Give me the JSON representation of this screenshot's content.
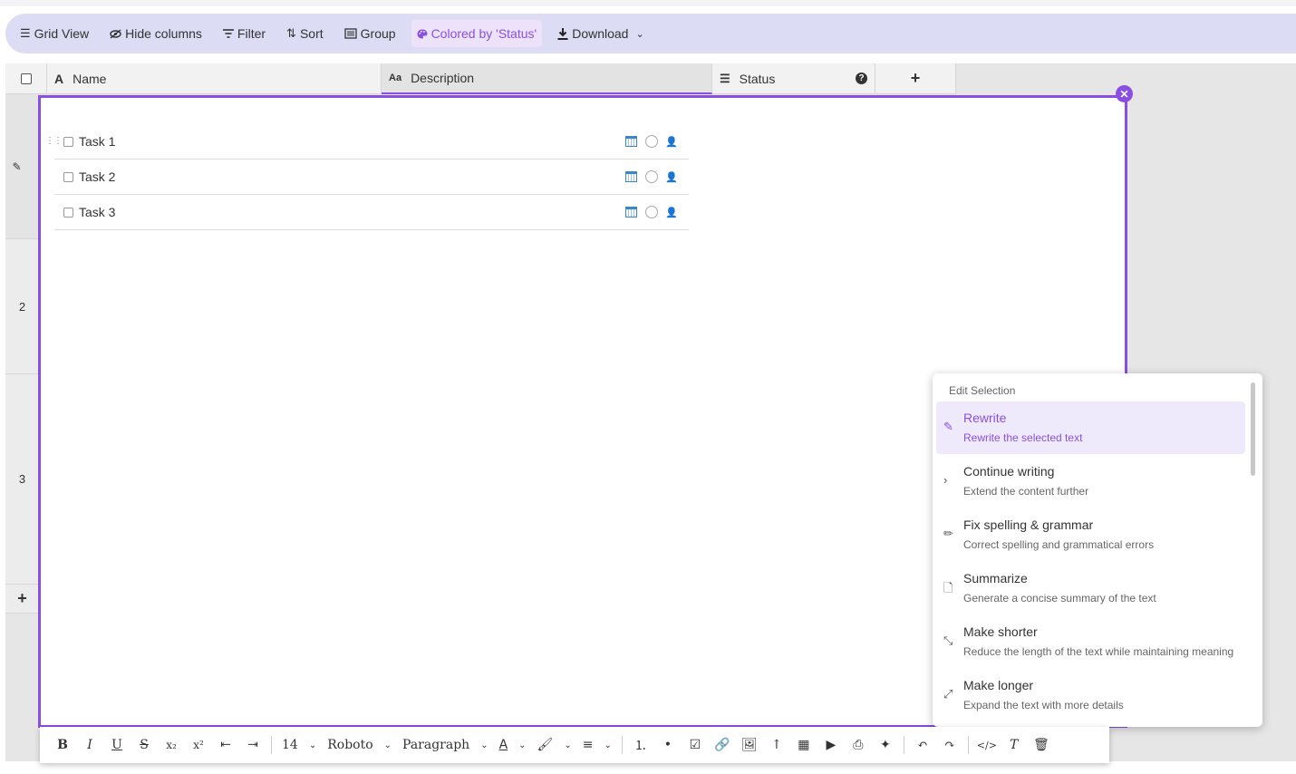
{
  "toolbar": {
    "grid_view": "Grid View",
    "hide_columns": "Hide columns",
    "filter": "Filter",
    "sort": "Sort",
    "group": "Group",
    "colored_by": "Colored by 'Status'",
    "download": "Download"
  },
  "columns": [
    {
      "label": "Name",
      "icon": "text-icon"
    },
    {
      "label": "Description",
      "icon": "long-text-icon"
    },
    {
      "label": "Status",
      "icon": "list-icon"
    }
  ],
  "rows": [
    "2",
    "3"
  ],
  "tasks": [
    {
      "label": "Task 1"
    },
    {
      "label": "Task 2"
    },
    {
      "label": "Task 3"
    }
  ],
  "ai_menu": {
    "heading": "Edit Selection",
    "items": [
      {
        "title": "Rewrite",
        "desc": "Rewrite the selected text",
        "icon": "edit-icon"
      },
      {
        "title": "Continue writing",
        "desc": "Extend the content further",
        "icon": "chevron-right-icon"
      },
      {
        "title": "Fix spelling & grammar",
        "desc": "Correct spelling and grammatical errors",
        "icon": "pencil-icon"
      },
      {
        "title": "Summarize",
        "desc": "Generate a concise summary of the text",
        "icon": "document-icon"
      },
      {
        "title": "Make shorter",
        "desc": "Reduce the length of the text while maintaining meaning",
        "icon": "shrink-icon"
      },
      {
        "title": "Make longer",
        "desc": "Expand the text with more details",
        "icon": "expand-icon"
      }
    ]
  },
  "editor_toolbar": {
    "font_size": "14",
    "font_family": "Roboto",
    "block_format": "Paragraph"
  },
  "colors": {
    "accent": "#8a4fe0",
    "toolbar_bg": "#dcdcf4"
  }
}
